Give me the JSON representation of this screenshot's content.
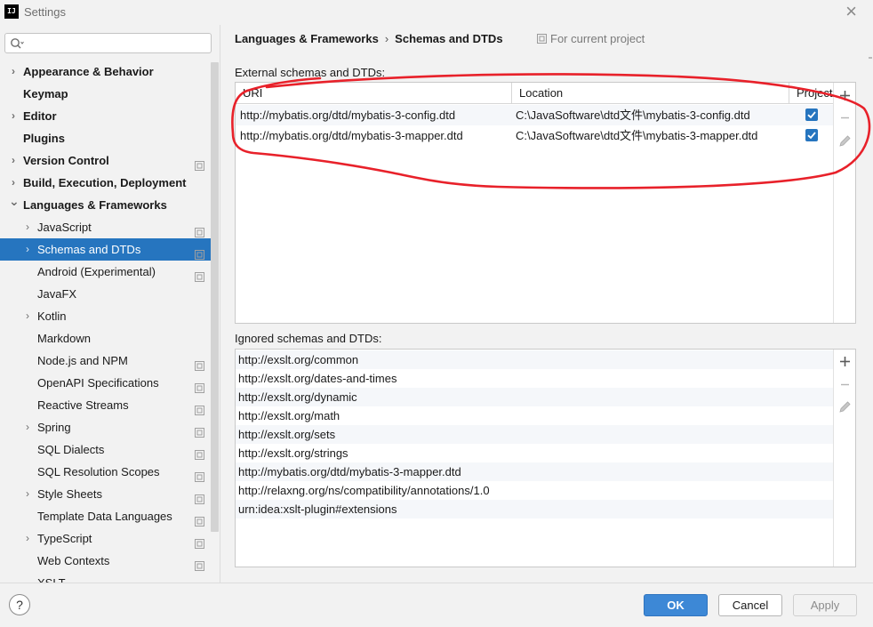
{
  "window": {
    "title": "Settings"
  },
  "search": {
    "value": "",
    "placeholder": ""
  },
  "sidebar": {
    "items": [
      {
        "label": "Appearance & Behavior",
        "bold": true,
        "chevron": "right",
        "indent": 0,
        "scope": false,
        "selected": false
      },
      {
        "label": "Keymap",
        "bold": true,
        "chevron": "",
        "indent": 0,
        "scope": false,
        "selected": false
      },
      {
        "label": "Editor",
        "bold": true,
        "chevron": "right",
        "indent": 0,
        "scope": false,
        "selected": false
      },
      {
        "label": "Plugins",
        "bold": true,
        "chevron": "",
        "indent": 0,
        "scope": false,
        "selected": false
      },
      {
        "label": "Version Control",
        "bold": true,
        "chevron": "right",
        "indent": 0,
        "scope": true,
        "selected": false
      },
      {
        "label": "Build, Execution, Deployment",
        "bold": true,
        "chevron": "right",
        "indent": 0,
        "scope": false,
        "selected": false
      },
      {
        "label": "Languages & Frameworks",
        "bold": true,
        "chevron": "down",
        "indent": 0,
        "scope": false,
        "selected": false
      },
      {
        "label": "JavaScript",
        "bold": false,
        "chevron": "right",
        "indent": 1,
        "scope": true,
        "selected": false
      },
      {
        "label": "Schemas and DTDs",
        "bold": false,
        "chevron": "right",
        "indent": 1,
        "scope": true,
        "selected": true
      },
      {
        "label": "Android (Experimental)",
        "bold": false,
        "chevron": "",
        "indent": 1,
        "scope": true,
        "selected": false
      },
      {
        "label": "JavaFX",
        "bold": false,
        "chevron": "",
        "indent": 1,
        "scope": false,
        "selected": false
      },
      {
        "label": "Kotlin",
        "bold": false,
        "chevron": "right",
        "indent": 1,
        "scope": false,
        "selected": false
      },
      {
        "label": "Markdown",
        "bold": false,
        "chevron": "",
        "indent": 1,
        "scope": false,
        "selected": false
      },
      {
        "label": "Node.js and NPM",
        "bold": false,
        "chevron": "",
        "indent": 1,
        "scope": true,
        "selected": false
      },
      {
        "label": "OpenAPI Specifications",
        "bold": false,
        "chevron": "",
        "indent": 1,
        "scope": true,
        "selected": false
      },
      {
        "label": "Reactive Streams",
        "bold": false,
        "chevron": "",
        "indent": 1,
        "scope": true,
        "selected": false
      },
      {
        "label": "Spring",
        "bold": false,
        "chevron": "right",
        "indent": 1,
        "scope": true,
        "selected": false
      },
      {
        "label": "SQL Dialects",
        "bold": false,
        "chevron": "",
        "indent": 1,
        "scope": true,
        "selected": false
      },
      {
        "label": "SQL Resolution Scopes",
        "bold": false,
        "chevron": "",
        "indent": 1,
        "scope": true,
        "selected": false
      },
      {
        "label": "Style Sheets",
        "bold": false,
        "chevron": "right",
        "indent": 1,
        "scope": true,
        "selected": false
      },
      {
        "label": "Template Data Languages",
        "bold": false,
        "chevron": "",
        "indent": 1,
        "scope": true,
        "selected": false
      },
      {
        "label": "TypeScript",
        "bold": false,
        "chevron": "right",
        "indent": 1,
        "scope": true,
        "selected": false
      },
      {
        "label": "Web Contexts",
        "bold": false,
        "chevron": "",
        "indent": 1,
        "scope": true,
        "selected": false
      },
      {
        "label": "XSLT",
        "bold": false,
        "chevron": "",
        "indent": 1,
        "scope": false,
        "selected": false
      }
    ]
  },
  "breadcrumb": {
    "parent": "Languages & Frameworks",
    "separator": "›",
    "current": "Schemas and DTDs"
  },
  "for_project": "For current project",
  "external": {
    "label": "External schemas and DTDs:",
    "columns": {
      "uri": "URI",
      "location": "Location",
      "project": "Project"
    },
    "rows": [
      {
        "uri": "http://mybatis.org/dtd/mybatis-3-config.dtd",
        "location": "C:\\JavaSoftware\\dtd文件\\mybatis-3-config.dtd",
        "project": true
      },
      {
        "uri": "http://mybatis.org/dtd/mybatis-3-mapper.dtd",
        "location": "C:\\JavaSoftware\\dtd文件\\mybatis-3-mapper.dtd",
        "project": true
      }
    ]
  },
  "ignored": {
    "label": "Ignored schemas and DTDs:",
    "items": [
      "http://exslt.org/common",
      "http://exslt.org/dates-and-times",
      "http://exslt.org/dynamic",
      "http://exslt.org/math",
      "http://exslt.org/sets",
      "http://exslt.org/strings",
      "http://mybatis.org/dtd/mybatis-3-mapper.dtd",
      "http://relaxng.org/ns/compatibility/annotations/1.0",
      "urn:idea:xslt-plugin#extensions"
    ]
  },
  "footer": {
    "help": "?",
    "ok": "OK",
    "cancel": "Cancel",
    "apply": "Apply"
  },
  "colors": {
    "accent": "#2675bf",
    "ok_button": "#3d88d6",
    "annotation": "#e8212a"
  }
}
